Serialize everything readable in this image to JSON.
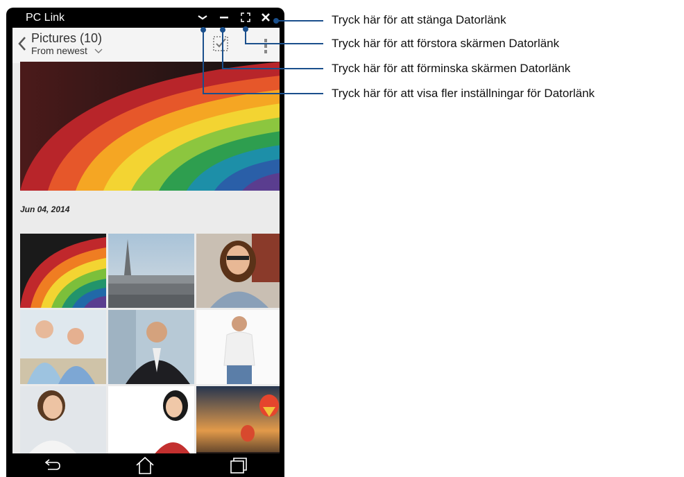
{
  "window": {
    "title": "PC Link"
  },
  "titlebar_icons": [
    "chevron-down-icon",
    "minimize-icon",
    "expand-icon",
    "close-icon"
  ],
  "appbar": {
    "title": "Pictures (10)",
    "sort": "From newest"
  },
  "gallery": {
    "date": "Jun 04,  2014",
    "thumbnails": [
      "rainbow-paper-thumbnail",
      "paris-cityscape-thumbnail",
      "woman-glasses-thumbnail",
      "elderly-couple-beach-thumbnail",
      "businessman-office-thumbnail",
      "man-white-tshirt-thumbnail",
      "businesswoman-thumbnail",
      "woman-red-dress-thumbnail",
      "hot-air-balloons-thumbnail"
    ]
  },
  "nav": [
    "back-icon",
    "home-icon",
    "recent-apps-icon"
  ],
  "callouts": {
    "close": "Tryck här för att stänga Datorlänk",
    "maximize": "Tryck här för att förstora skärmen Datorlänk",
    "minimize": "Tryck här för att förminska skärmen Datorlänk",
    "settings": "Tryck här för att visa fler inställningar för Datorlänk"
  },
  "colors": {
    "callout_line": "#1a4f8c",
    "titlebar": "#000000",
    "screen_bg": "#ebebeb"
  }
}
